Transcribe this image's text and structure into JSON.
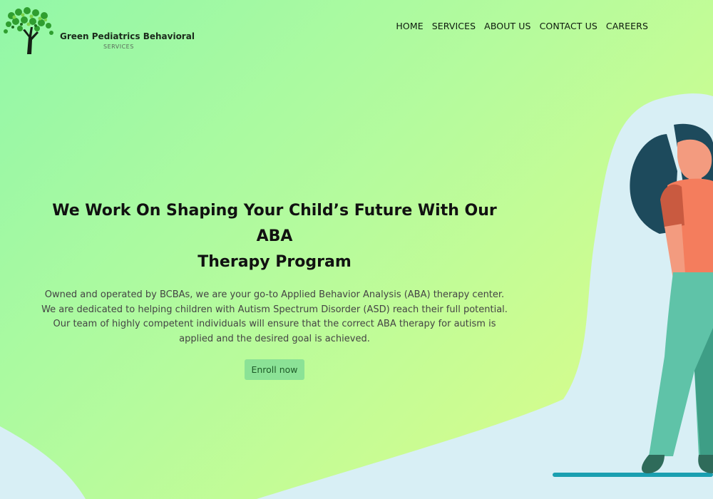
{
  "brand": {
    "name": "Green Pediatrics Behavioral",
    "subtitle": "SERVICES"
  },
  "nav": {
    "items": [
      {
        "label": "HOME"
      },
      {
        "label": "SERVICES"
      },
      {
        "label": "ABOUT US"
      },
      {
        "label": "CONTACT US"
      },
      {
        "label": "CAREERS"
      }
    ]
  },
  "hero": {
    "title_line1": "We Work On Shaping Your Child’s Future With Our ABA",
    "title_line2": "Therapy Program",
    "description": "Owned and operated by BCBAs, we are your go-to Applied Behavior Analysis (ABA) therapy center. We are dedicated to helping children with Autism Spectrum Disorder (ASD) reach their full potential. Our team of highly competent individuals will ensure that the correct ABA therapy for autism is applied and the desired goal is achieved.",
    "cta_label": "Enroll now"
  },
  "colors": {
    "bg_gradient_start": "#92f7a8",
    "bg_gradient_end": "#e2fd86",
    "wave": "#d8eff5",
    "cta_bg": "#8be296",
    "cta_text": "#1d5a28"
  },
  "icons": {
    "logo": "tree-icon",
    "illustration": "woman-illustration"
  }
}
